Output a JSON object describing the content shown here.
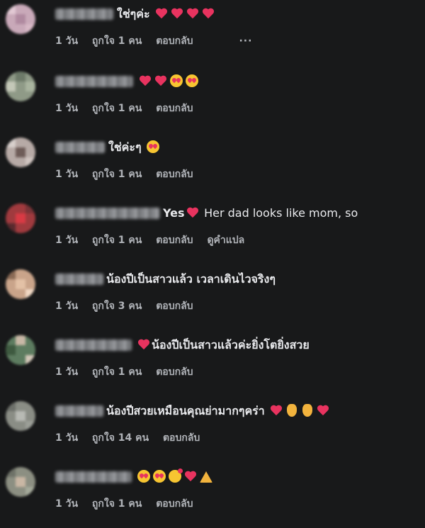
{
  "comments": [
    {
      "text": "ใช่ๆค่ะ",
      "time": "1 วัน",
      "like": "ถูกใจ 1 คน",
      "reply": "ตอบกลับ",
      "more": "···",
      "emojis": [
        "heart",
        "heart",
        "heart",
        "heart"
      ]
    },
    {
      "text": "",
      "time": "1 วัน",
      "like": "ถูกใจ 1 คน",
      "reply": "ตอบกลับ",
      "emojis": [
        "heart",
        "heart",
        "heart-eyes",
        "heart-eyes"
      ]
    },
    {
      "text": "ใช่ค่ะๆ",
      "time": "1 วัน",
      "like": "ถูกใจ 1 คน",
      "reply": "ตอบกลับ",
      "emojis": [
        "heart-eyes"
      ]
    },
    {
      "text": "Yes",
      "text_after": "Her dad looks like mom, so",
      "time": "1 วัน",
      "like": "ถูกใจ 1 คน",
      "reply": "ตอบกลับ",
      "translate": "ดูคำแปล",
      "emojis": [
        "heart"
      ]
    },
    {
      "text": "น้องปีเป็นสาวแล้ว เวลาเดินไวจริงๆ",
      "time": "1 วัน",
      "like": "ถูกใจ 3 คน",
      "reply": "ตอบกลับ",
      "emojis": []
    },
    {
      "text": "น้องปีเป็นสาวแล้วค่ะยิ่งโตยิ่งสวย",
      "time": "1 วัน",
      "like": "ถูกใจ 1 คน",
      "reply": "ตอบกลับ",
      "emojis": [
        "heart"
      ]
    },
    {
      "text": "น้องปีสวยเหมือนคุณย่ามากๆคร่า",
      "time": "1 วัน",
      "like": "ถูกใจ 14 คน",
      "reply": "ตอบกลับ",
      "emojis": [
        "heart",
        "pinched-fingers",
        "pinched-fingers",
        "heart"
      ]
    },
    {
      "text": "",
      "time": "1 วัน",
      "like": "ถูกใจ 1 คน",
      "reply": "ตอบกลับ",
      "emojis": [
        "heart-eyes",
        "heart-eyes",
        "smiling-hearts",
        "heart",
        "folded-hands"
      ]
    }
  ],
  "colors": {
    "background": "#18191a",
    "text": "#e9eaed",
    "meta": "#b0b3b8",
    "heart": "#e8335f",
    "emoji_yellow": "#f7c531"
  }
}
